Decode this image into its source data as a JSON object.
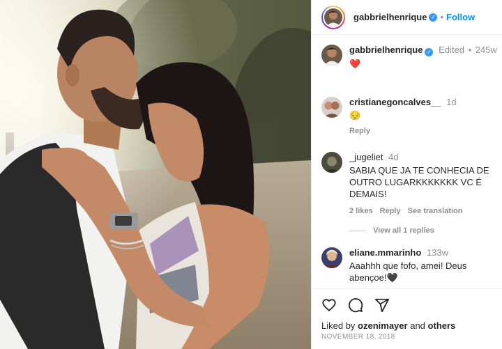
{
  "post": {
    "author": "gabbrielhenrique",
    "follow_label": "Follow",
    "separator": "•"
  },
  "caption": {
    "author": "gabbrielhenrique",
    "edited": "Edited",
    "time": "245w",
    "text": "❤️"
  },
  "comments": [
    {
      "user": "cristianegoncalves__",
      "time": "1d",
      "text": "😔",
      "reply_label": "Reply"
    },
    {
      "user": "_jugeliet",
      "time": "4d",
      "text": "SABIA QUE JA TE CONHECIA DE OUTRO LUGARKKKKKKK VC É DEMAIS!",
      "likes": "2 likes",
      "reply_label": "Reply",
      "translation_label": "See translation"
    },
    {
      "view_replies": "View all 1 replies"
    },
    {
      "user": "eliane.mmarinho",
      "time": "133w",
      "text": "Aaahhh que fofo, amei! Deus abençoe!🖤"
    }
  ],
  "footer": {
    "liked_prefix": "Liked by",
    "liked_user": "ozenimayer",
    "liked_and": "and",
    "liked_others": "others",
    "date": "NOVEMBER 18, 2018"
  },
  "colors": {
    "accent": "#0095f6",
    "verified": "#3897f0",
    "heart": "#ed4956",
    "muted": "#8e8e8e"
  },
  "icons": {
    "like": "heart-outline-icon",
    "comment": "speech-bubble-icon",
    "share": "paper-plane-icon",
    "verified": "verified-badge-icon"
  }
}
